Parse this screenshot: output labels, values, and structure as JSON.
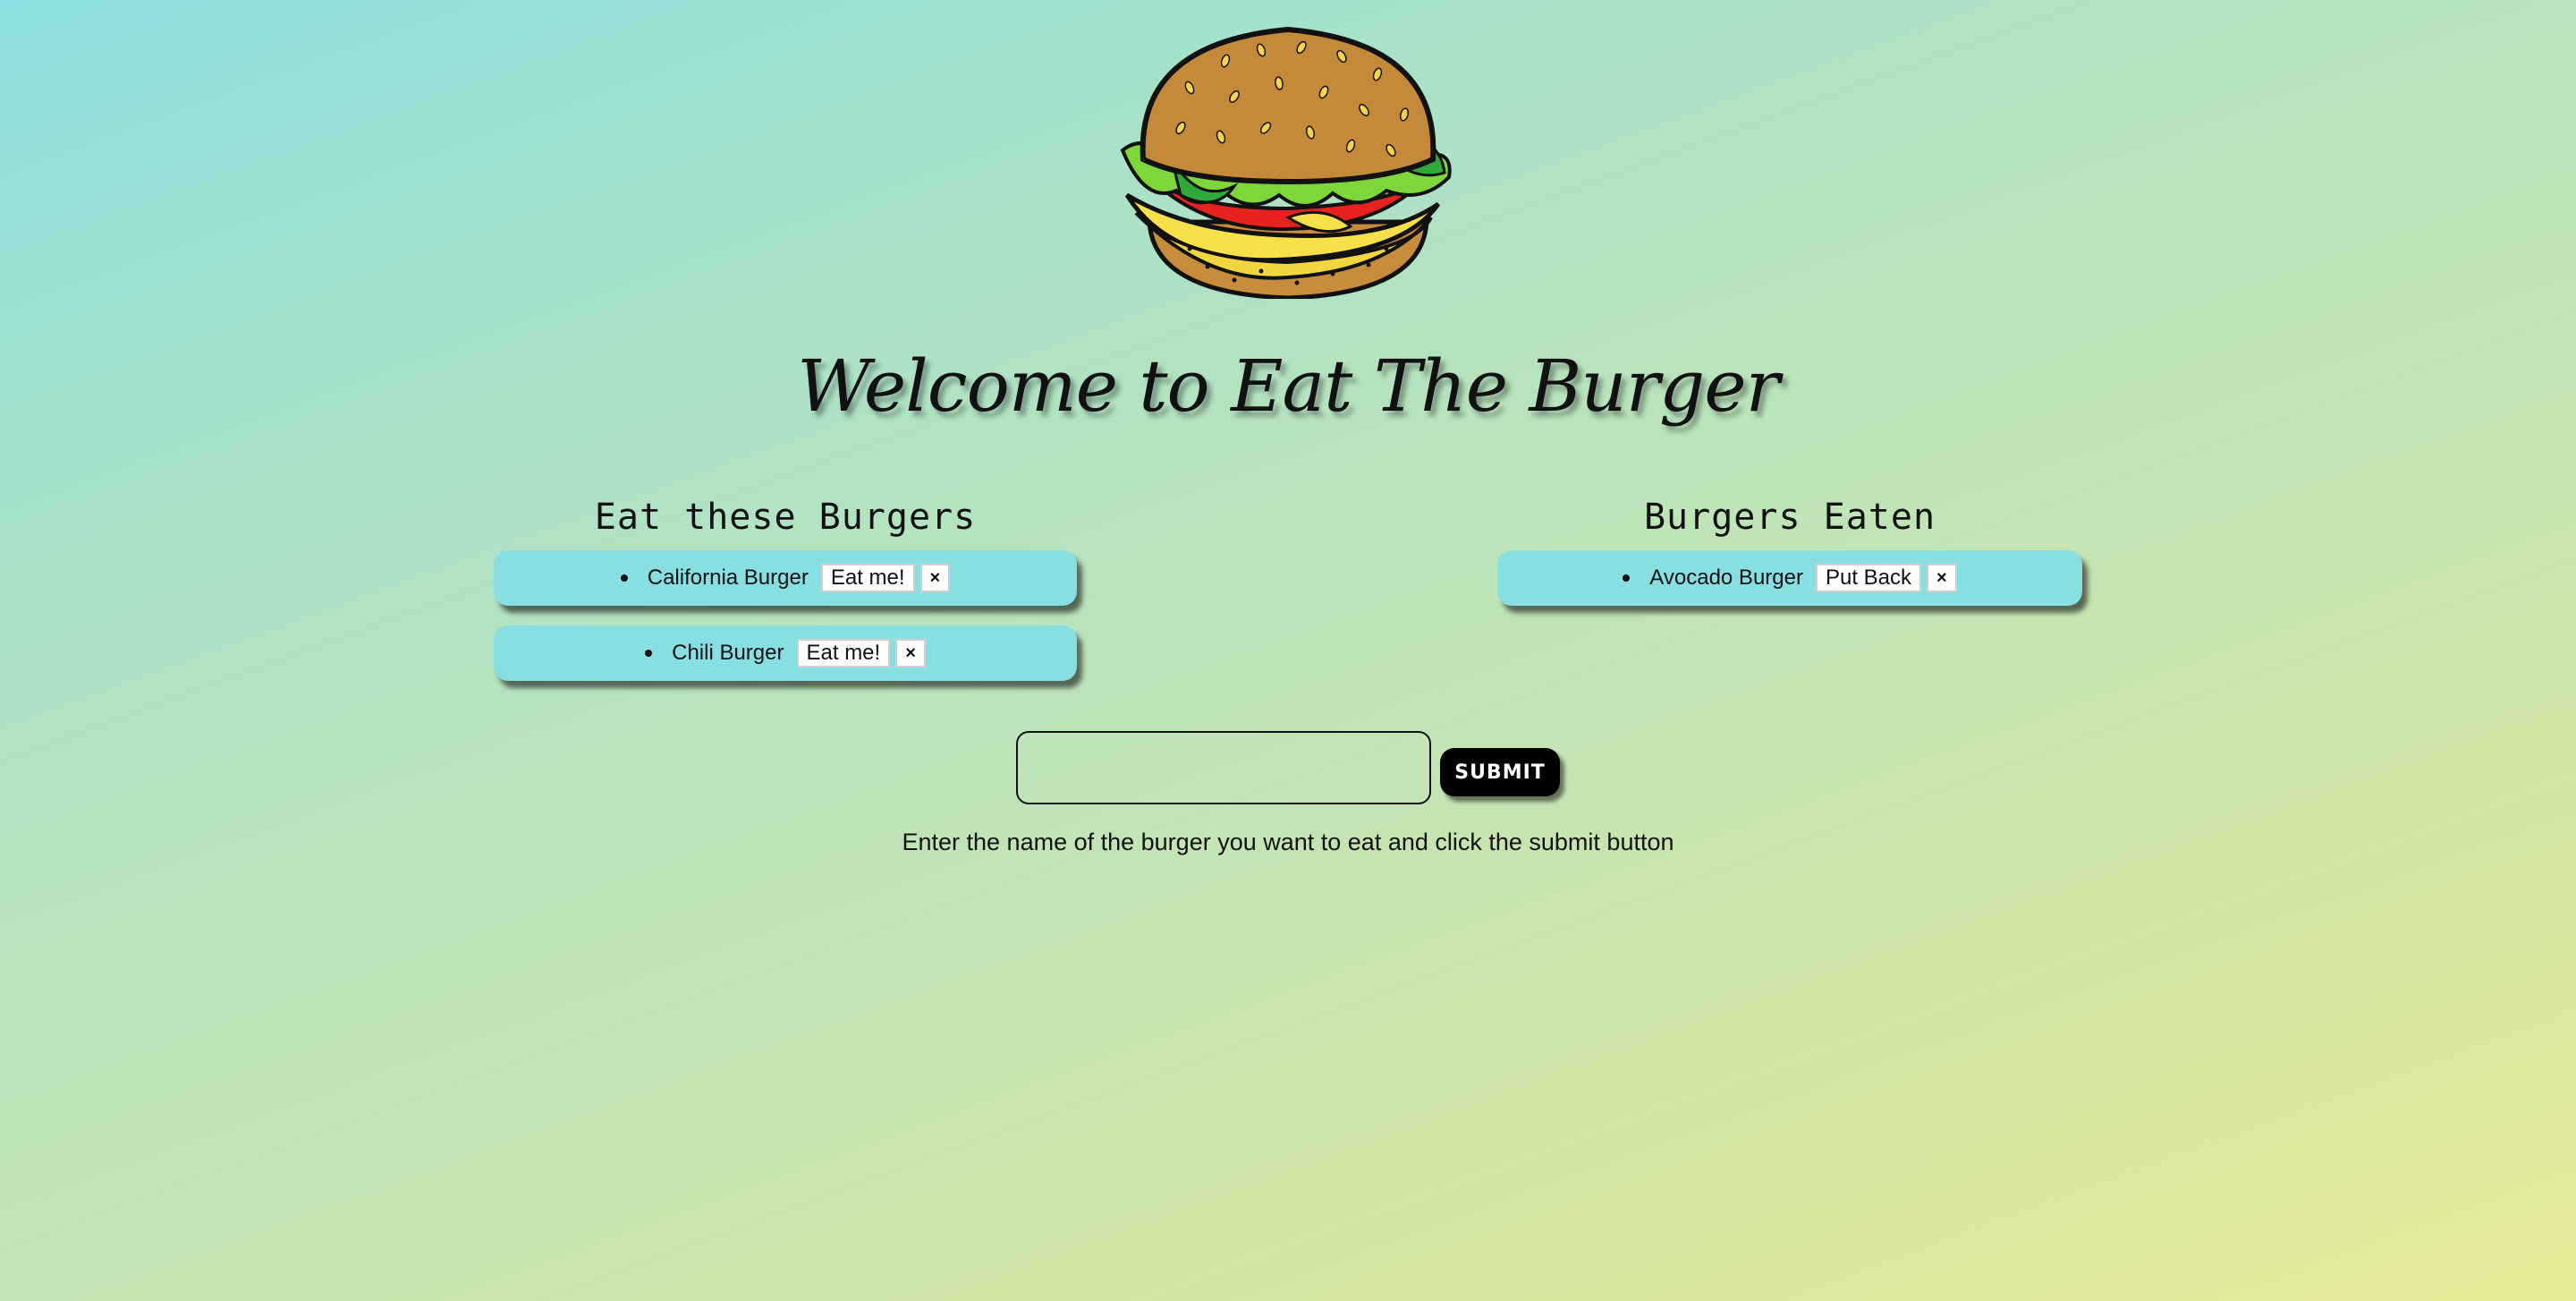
{
  "logo": {
    "icon": "burger-icon"
  },
  "welcome_title": "Welcome to Eat The Burger",
  "to_eat": {
    "heading": "Eat these Burgers",
    "items": [
      {
        "name": "California Burger",
        "action_label": "Eat me!",
        "delete_label": "×"
      },
      {
        "name": "Chili Burger",
        "action_label": "Eat me!",
        "delete_label": "×"
      }
    ]
  },
  "eaten": {
    "heading": "Burgers Eaten",
    "items": [
      {
        "name": "Avocado Burger",
        "action_label": "Put Back",
        "delete_label": "×"
      }
    ]
  },
  "form": {
    "input_value": "",
    "submit_label": "SUBMIT",
    "hint": "Enter the name of the burger you want to eat and click the submit button"
  },
  "colors": {
    "card_bg": "#88dfe2",
    "submit_bg": "#000000",
    "gradient_start": "#8bdfe0",
    "gradient_end": "#e7ea95"
  }
}
